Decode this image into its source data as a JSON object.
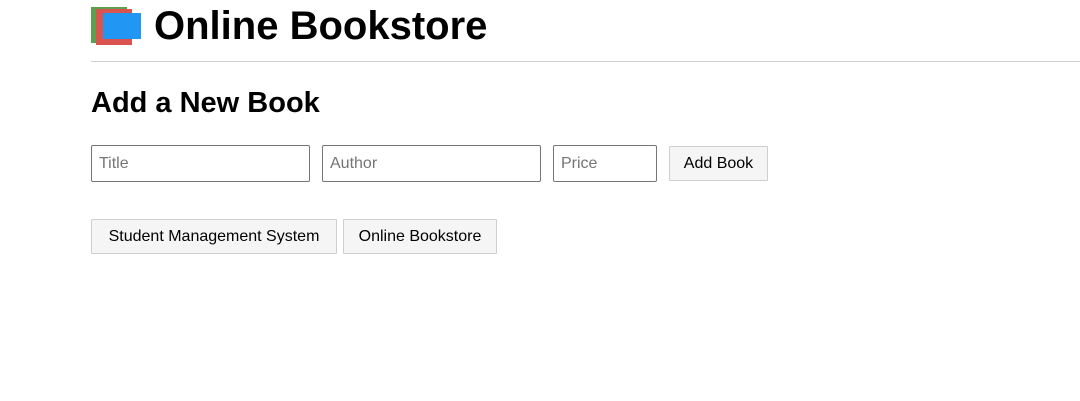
{
  "header": {
    "title": "Online Bookstore"
  },
  "form": {
    "heading": "Add a New Book",
    "title_placeholder": "Title",
    "title_value": "",
    "author_placeholder": "Author",
    "author_value": "",
    "price_placeholder": "Price",
    "price_value": "",
    "submit_label": "Add Book"
  },
  "nav": {
    "student_management_label": "Student Management System",
    "online_bookstore_label": "Online Bookstore"
  },
  "colors": {
    "logo_green": "#5b9f4f",
    "logo_red": "#d9534f",
    "logo_blue": "#2196f3"
  }
}
